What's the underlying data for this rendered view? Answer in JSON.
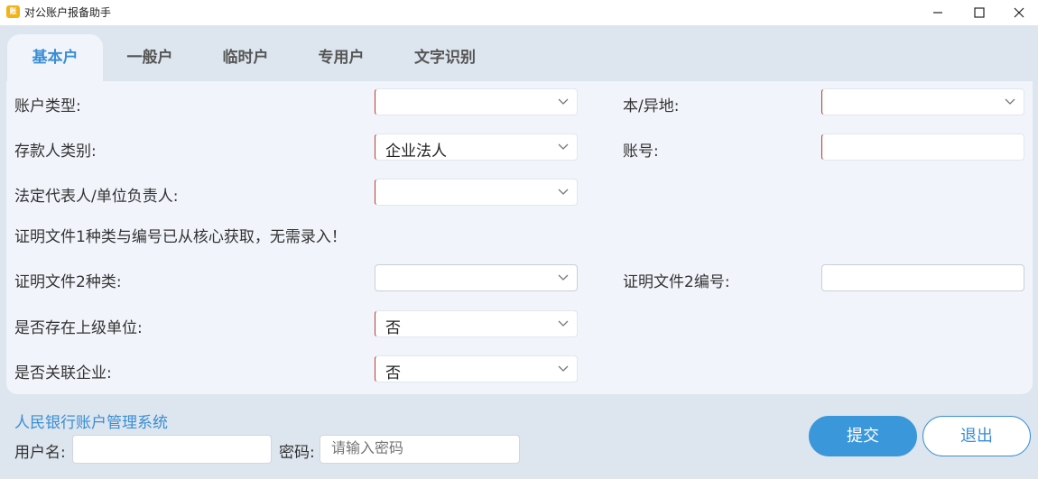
{
  "window": {
    "title": "对公账户报备助手"
  },
  "tabs": [
    {
      "label": "基本户",
      "active": true
    },
    {
      "label": "一般户"
    },
    {
      "label": "临时户"
    },
    {
      "label": "专用户"
    },
    {
      "label": "文字识别"
    }
  ],
  "form": {
    "account_type": {
      "label": "账户类型:",
      "value": ""
    },
    "locality": {
      "label": "本/异地:",
      "value": ""
    },
    "depositor_category": {
      "label": "存款人类别:",
      "value": "企业法人"
    },
    "account_number": {
      "label": "账号:",
      "value": ""
    },
    "legal_rep": {
      "label": "法定代表人/单位负责人:",
      "value": ""
    },
    "doc1_notice": "证明文件1种类与编号已从核心获取，无需录入！",
    "doc2_type": {
      "label": "证明文件2种类:",
      "value": ""
    },
    "doc2_number": {
      "label": "证明文件2编号:",
      "value": ""
    },
    "has_superior": {
      "label": "是否存在上级单位:",
      "value": "否"
    },
    "related_company": {
      "label": "是否关联企业:",
      "value": "否"
    }
  },
  "login": {
    "system_title": "人民银行账户管理系统",
    "username_label": "用户名:",
    "username_value": "",
    "password_label": "密码:",
    "password_placeholder": "请输入密码"
  },
  "actions": {
    "submit": "提交",
    "exit": "退出"
  },
  "colors": {
    "accent": "#3a97da",
    "required_marker": "#c0392b",
    "background": "#dde5ee"
  }
}
